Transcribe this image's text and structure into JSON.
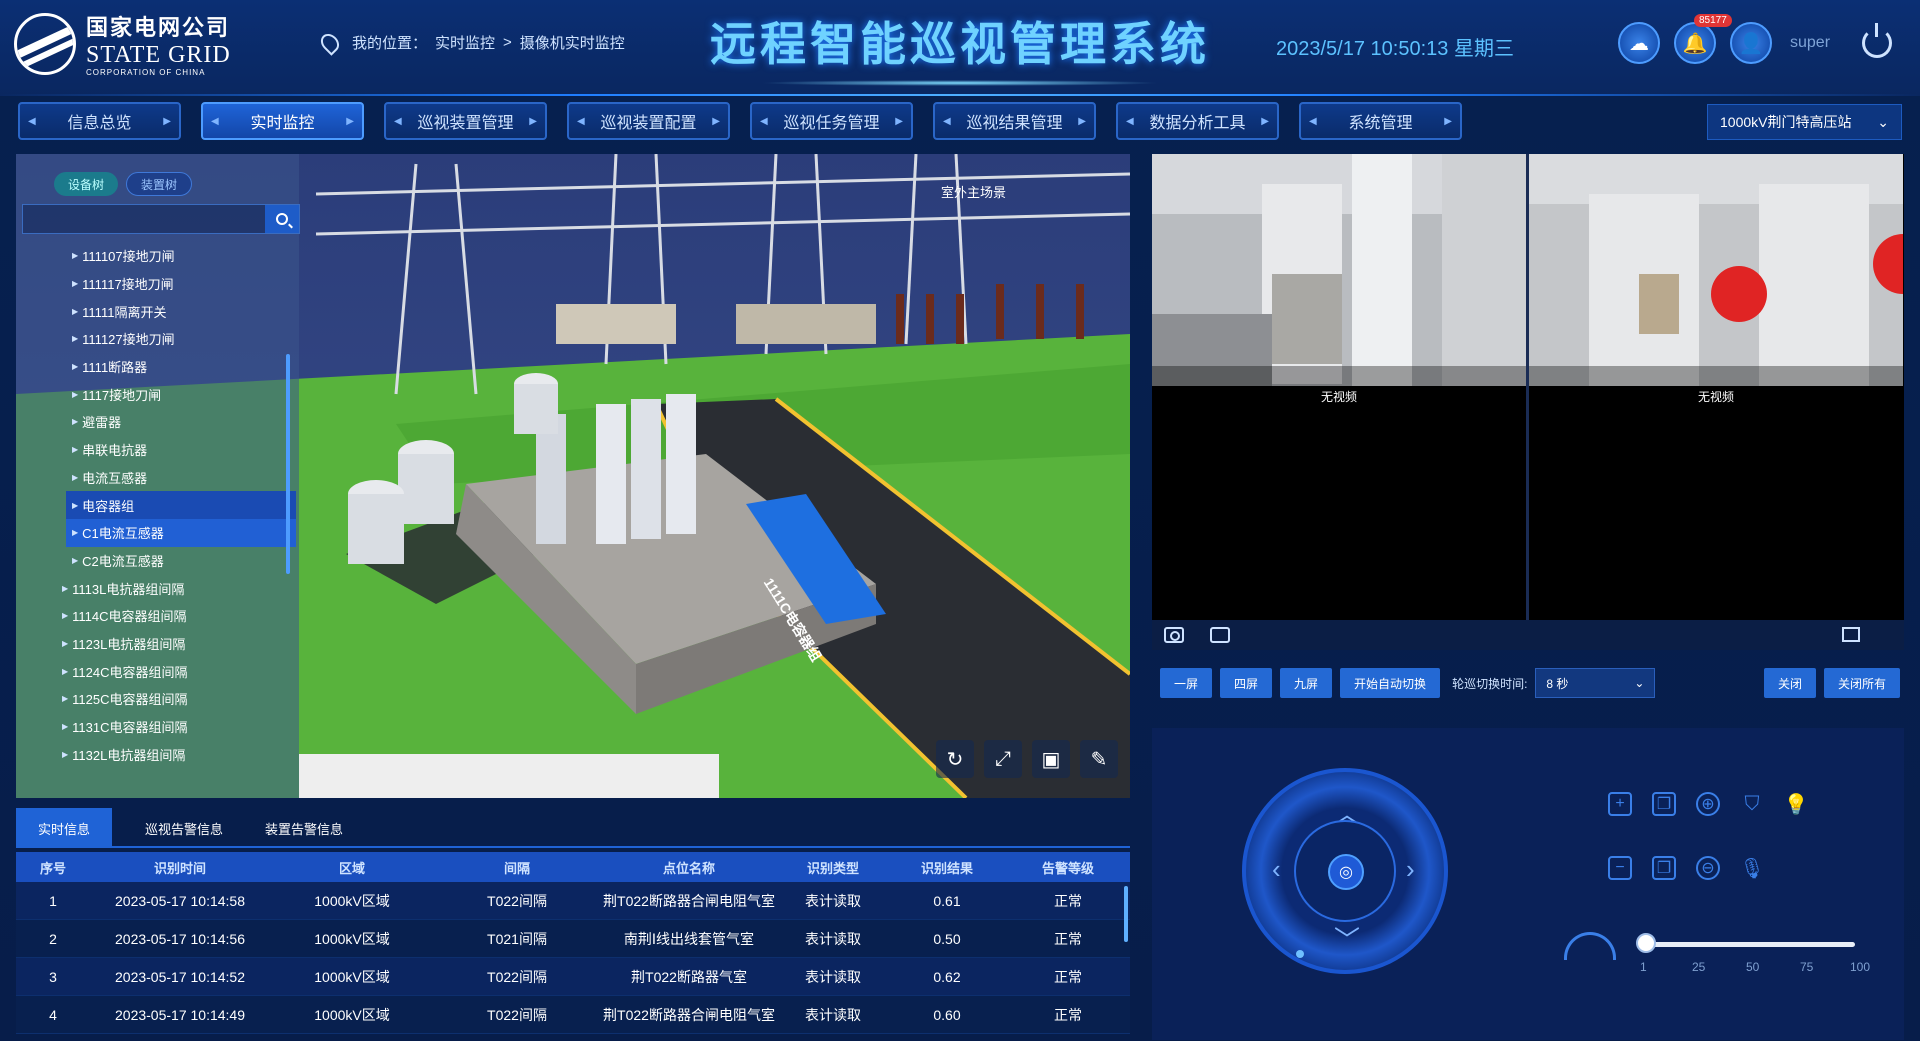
{
  "header": {
    "logo_cn": "国家电网公司",
    "logo_en": "STATE GRID",
    "logo_sub": "CORPORATION OF CHINA",
    "location_prefix": "我的位置：",
    "location_items": [
      "实时监控",
      "摄像机实时监控"
    ],
    "location_sep": ">",
    "title": "远程智能巡视管理系统",
    "datetime": "2023/5/17 10:50:13 星期三",
    "alarm_count": "85177",
    "user": "super"
  },
  "nav": {
    "tabs": [
      {
        "label": "信息总览"
      },
      {
        "label": "实时监控",
        "active": true
      },
      {
        "label": "巡视装置管理"
      },
      {
        "label": "巡视装置配置"
      },
      {
        "label": "巡视任务管理"
      },
      {
        "label": "巡视结果管理"
      },
      {
        "label": "数据分析工具"
      },
      {
        "label": "系统管理"
      }
    ],
    "station": "1000kV荆门特高压站"
  },
  "tree": {
    "tabs": [
      "设备树",
      "装置树"
    ],
    "items": [
      {
        "label": "111107接地刀闸"
      },
      {
        "label": "111117接地刀闸"
      },
      {
        "label": "11111隔离开关"
      },
      {
        "label": "111127接地刀闸"
      },
      {
        "label": "1111断路器"
      },
      {
        "label": "1117接地刀闸"
      },
      {
        "label": "避雷器"
      },
      {
        "label": "串联电抗器"
      },
      {
        "label": "电流互感器"
      },
      {
        "label": "电容器组"
      },
      {
        "label": "C1电流互感器",
        "selected": true
      },
      {
        "label": "C2电流互感器"
      },
      {
        "label": "1113L电抗器组间隔"
      },
      {
        "label": "1114C电容器组间隔"
      },
      {
        "label": "1123L电抗器组间隔"
      },
      {
        "label": "1124C电容器组间隔"
      },
      {
        "label": "1125C电容器组间隔"
      },
      {
        "label": "1131C电容器组间隔"
      },
      {
        "label": "1132L电抗器组间隔"
      }
    ]
  },
  "scene": {
    "area_label": "室外主场景",
    "sign_text": "1111C电容器组"
  },
  "videos": {
    "no_video": "无视频"
  },
  "video_bar": {
    "buttons": [
      "一屏",
      "四屏",
      "九屏",
      "开始自动切换"
    ],
    "interval_label": "轮巡切换时间:",
    "interval_value": "8 秒",
    "close": "关闭",
    "close_all": "关闭所有"
  },
  "ptz": {
    "speed": 0,
    "ticks": [
      "1",
      "25",
      "50",
      "75",
      "100"
    ]
  },
  "bottom": {
    "tabs": [
      "实时信息",
      "巡视告警信息",
      "装置告警信息"
    ],
    "columns": [
      "序号",
      "识别时间",
      "区域",
      "间隔",
      "点位名称",
      "识别类型",
      "识别结果",
      "告警等级"
    ],
    "rows": [
      [
        "1",
        "2023-05-17 10:14:58",
        "1000kV区域",
        "T022间隔",
        "荆T022断路器合闸电阻气室",
        "表计读取",
        "0.61",
        "正常"
      ],
      [
        "2",
        "2023-05-17 10:14:56",
        "1000kV区域",
        "T021间隔",
        "南荆Ⅰ线出线套管气室",
        "表计读取",
        "0.50",
        "正常"
      ],
      [
        "3",
        "2023-05-17 10:14:52",
        "1000kV区域",
        "T022间隔",
        "荆T022断路器气室",
        "表计读取",
        "0.62",
        "正常"
      ],
      [
        "4",
        "2023-05-17 10:14:49",
        "1000kV区域",
        "T022间隔",
        "荆T022断路器合闸电阻气室",
        "表计读取",
        "0.60",
        "正常"
      ]
    ]
  }
}
